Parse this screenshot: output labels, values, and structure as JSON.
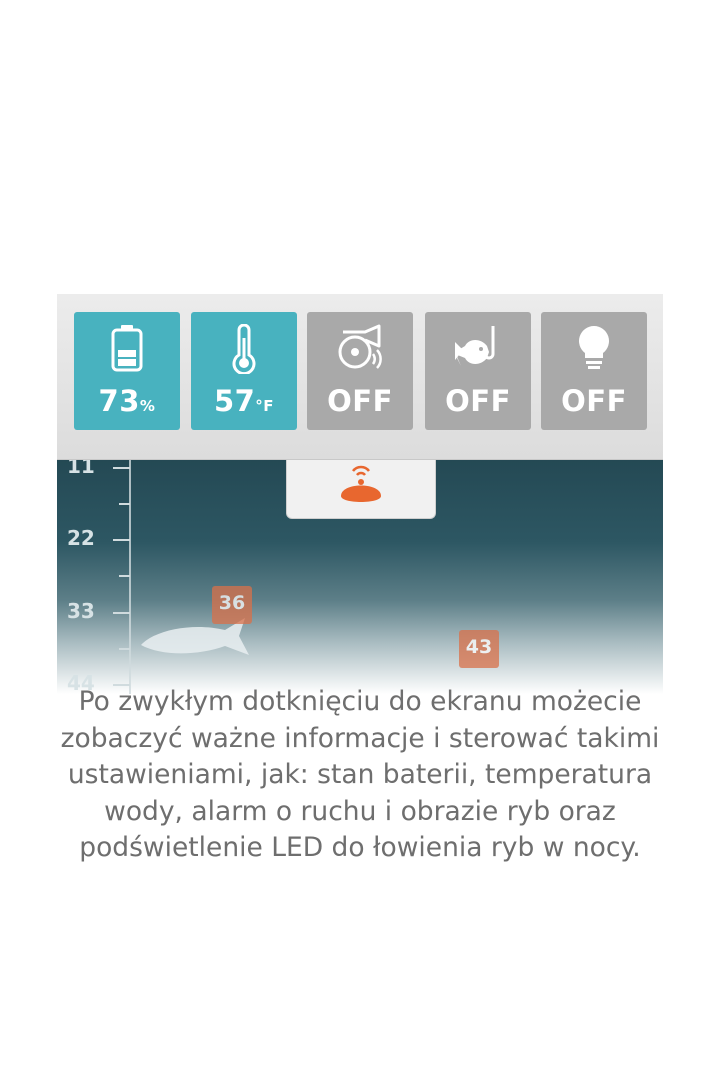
{
  "toolbar": {
    "battery": {
      "value": "73",
      "unit": "%",
      "icon": "battery-icon",
      "state": "on"
    },
    "temperature": {
      "value": "57",
      "unit": "°F",
      "icon": "thermometer-icon",
      "state": "on"
    },
    "alarm": {
      "value": "OFF",
      "icon": "alarm-bell-icon",
      "state": "off"
    },
    "fish_alarm": {
      "value": "OFF",
      "icon": "fish-hook-icon",
      "state": "off"
    },
    "led_light": {
      "value": "OFF",
      "icon": "light-bulb-icon",
      "state": "off"
    }
  },
  "sonar": {
    "depth_labels": [
      "11",
      "22",
      "33",
      "44"
    ],
    "fish_depths": [
      "36",
      "43"
    ],
    "device_icon": "sonar-device-icon"
  },
  "caption": "Po zwykłym dotknięciu do ekranu możecie zobaczyć ważne informacje i sterować takimi ustawieniami, jak: stan baterii, temperatura wody, alarm o ruchu i obrazie ryb oraz podświetlenie LED do łowienia ryb w nocy.",
  "colors": {
    "accent": "#48b2bf",
    "off_tile": "#a9a9a9",
    "fish_badge": "#d9714a",
    "device": "#e8672f"
  }
}
